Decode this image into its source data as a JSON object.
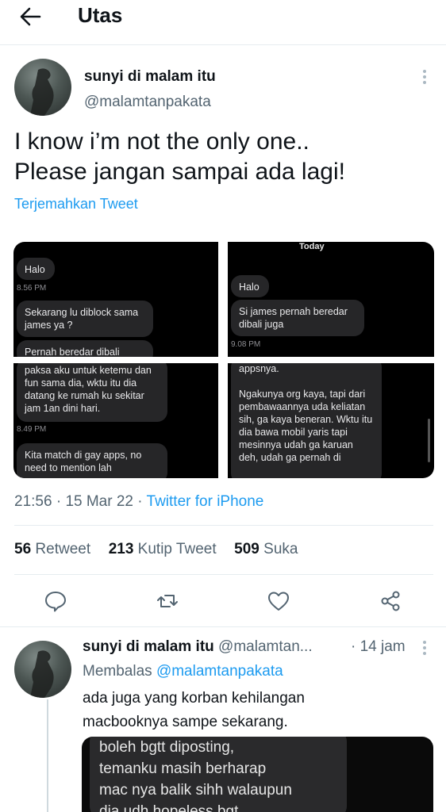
{
  "header": {
    "back_icon": "arrow-left-icon",
    "title": "Utas"
  },
  "main_tweet": {
    "author_name": "sunyi di malam itu",
    "handle": "@malamtanpakata",
    "text_line1": "I know i’m not the only one..",
    "text_line2": "Please jangan sampai ada lagi!",
    "translate_label": "Terjemahkan Tweet",
    "images": {
      "img1": {
        "b1": "Halo",
        "t1": "8.56 PM",
        "b2": "Sekarang lu diblock sama james ya ?",
        "b3": "Pernah beredar dibali"
      },
      "img2": {
        "header": "Today",
        "b1": "Halo",
        "b2": "Si james pernah beredar dibali juga",
        "t1": "9.08 PM"
      },
      "img3": {
        "b1": "paksa aku untuk ketemu dan fun sama dia, wktu itu dia datang ke rumah ku sekitar jam 1an dini hari.",
        "t1": "8.49 PM",
        "b2": "Kita match di gay apps, no need to mention lah"
      },
      "img4": {
        "b1": "appsnya.\n\nNgakunya org kaya, tapi dari pembawaannya uda keliatan sih, ga kaya beneran. Wktu itu dia bawa mobil yaris tapi mesinnya udah ga karuan deh, udah ga pernah di"
      }
    },
    "time": "21:56",
    "date": "15 Mar 22",
    "source": "Twitter for iPhone",
    "stats": {
      "retweets": "56",
      "retweets_label": "Retweet",
      "quotes": "213",
      "quotes_label": "Kutip Tweet",
      "likes": "509",
      "likes_label": "Suka"
    },
    "actions": [
      "reply-icon",
      "retweet-icon",
      "like-icon",
      "share-icon"
    ]
  },
  "reply_tweet": {
    "author_name": "sunyi di malam itu",
    "handle": "@malamtan...",
    "time": "· 14 jam",
    "replying_label": "Membalas",
    "replying_to": "@malamtanpakata",
    "text_line1": "ada juga yang korban kehilangan",
    "text_line2": "macbooknya sampe sekarang.",
    "image_text": "boleh bgtt diposting,\ntemanku masih berharap\nmac nya balik sihh walaupun\ndia udh hopeless bgt"
  },
  "colors": {
    "accent": "#1d9bf0",
    "text": "#0f1419",
    "muted": "#536471",
    "divider": "#e6ecf0"
  }
}
